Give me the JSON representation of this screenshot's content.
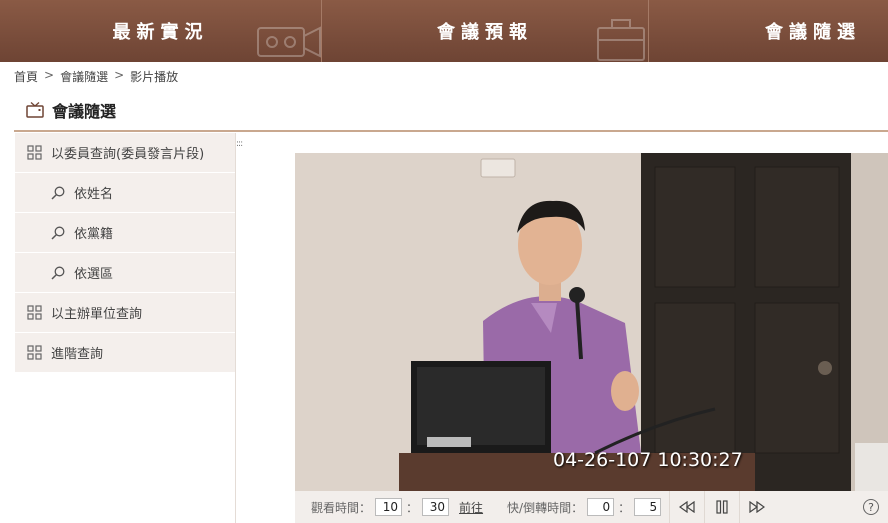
{
  "nav": {
    "items": [
      {
        "label": "最新實況",
        "icon": "video-camera-icon"
      },
      {
        "label": "會議預報",
        "icon": "briefcase-icon"
      },
      {
        "label": "會議隨選",
        "icon": "play-icon"
      }
    ]
  },
  "breadcrumb": {
    "items": [
      "首頁",
      "會議隨選",
      "影片播放"
    ],
    "separator": ">"
  },
  "page": {
    "title": "會議隨選",
    "title_icon": "tv-icon"
  },
  "sidebar": {
    "items": [
      {
        "label": "以委員查詢(委員發言片段)",
        "icon": "grid-icon",
        "level": 0
      },
      {
        "label": "依姓名",
        "icon": "search-icon",
        "level": 1
      },
      {
        "label": "依黨籍",
        "icon": "search-icon",
        "level": 1
      },
      {
        "label": "依選區",
        "icon": "search-icon",
        "level": 1
      },
      {
        "label": "以主辦單位查詢",
        "icon": "grid-icon",
        "level": 0
      },
      {
        "label": "進階查詢",
        "icon": "grid-icon",
        "level": 0
      }
    ]
  },
  "video": {
    "timestamp_overlay": "04-26-107  10:30:27"
  },
  "controls": {
    "watch_time_label": "觀看時間：",
    "watch_hour": "10",
    "watch_colon": "：",
    "watch_minute": "30",
    "goto_label": "前往",
    "seek_label": "快/倒轉時間：",
    "seek_min": "0",
    "seek_colon": "：",
    "seek_sec": "5",
    "help_label": "?"
  },
  "colors": {
    "nav_bg": "#7b4e3c",
    "sidebar_bg": "#f4efec",
    "rule": "#c9a88f"
  }
}
